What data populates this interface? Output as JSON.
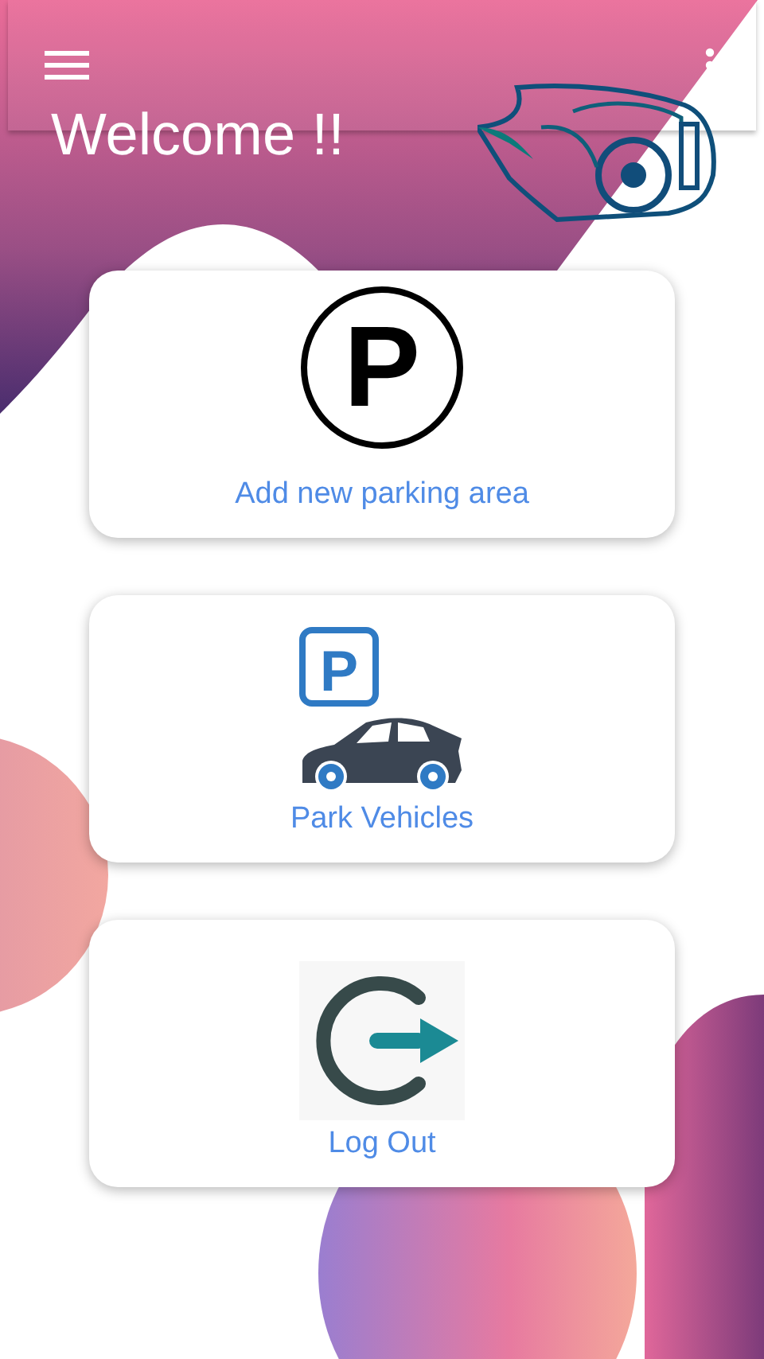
{
  "header": {
    "title": "Welcome !!"
  },
  "cards": [
    {
      "kind": "parking-sign",
      "icon_letter": "P",
      "label": "Add new parking area"
    },
    {
      "kind": "park-car",
      "icon_letter": "P",
      "label": "Park Vehicles"
    },
    {
      "kind": "logout",
      "label": "Log Out"
    }
  ]
}
